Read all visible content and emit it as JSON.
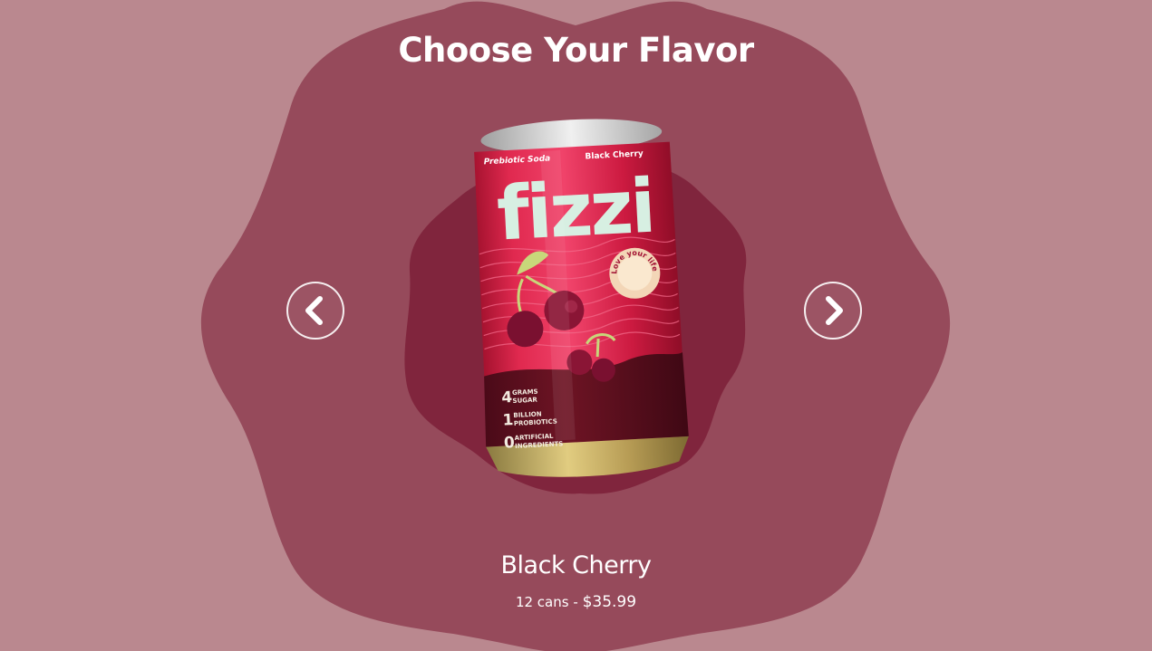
{
  "colors": {
    "page_bg": "#ba888f",
    "blob_outer": "#964a5b",
    "blob_inner": "#80253d",
    "text": "#ffffff",
    "can_red": "#d51c45",
    "can_dark": "#5b0f1e",
    "can_logo": "#d7efe2"
  },
  "header": {
    "title": "Choose Your Flavor"
  },
  "carousel": {
    "prev_icon": "chevron-left-icon",
    "next_icon": "chevron-right-icon"
  },
  "product": {
    "can_label_top_left": "Prebiotic Soda",
    "can_label_top_right": "Black Cherry",
    "can_brand": "fizzi",
    "can_badge": "Love your life",
    "can_stats": [
      {
        "num": "4",
        "line1": "GRAMS",
        "line2": "SUGAR"
      },
      {
        "num": "1",
        "line1": "BILLION",
        "line2": "PROBIOTICS"
      },
      {
        "num": "0",
        "line1": "ARTIFICIAL",
        "line2": "INGREDIENTS"
      }
    ],
    "name": "Black Cherry",
    "quantity": "12 cans",
    "separator": "-",
    "price": "$35.99"
  }
}
